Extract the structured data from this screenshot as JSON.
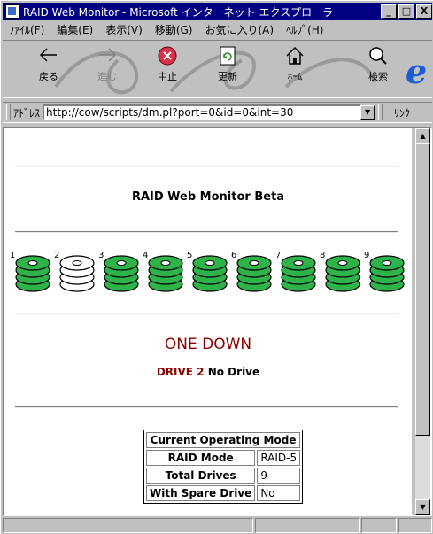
{
  "window": {
    "title": "RAID Web Monitor - Microsoft インターネット エクスプローラ",
    "controls": {
      "minimize": "_",
      "maximize": "□",
      "close": "X"
    }
  },
  "menu": [
    "ﾌｧｲﾙ(F)",
    "編集(E)",
    "表示(V)",
    "移動(G)",
    "お気に入り(A)",
    "ﾍﾙﾌﾟ(H)"
  ],
  "toolbar": {
    "back": "戻る",
    "forward": "進む",
    "stop": "中止",
    "refresh": "更新",
    "home": "ﾎｰﾑ",
    "search": "検索"
  },
  "address": {
    "label": "ｱﾄﾞﾚｽ",
    "url": "http://cow/scripts/dm.pl?port=0&id=0&int=30",
    "links": "ﾘﾝｸ"
  },
  "page": {
    "title": "RAID Web Monitor Beta",
    "status": "ONE DOWN",
    "detail_drive": "DRIVE 2",
    "detail_state": "No Drive"
  },
  "drives": [
    {
      "label": "1",
      "state": "ok"
    },
    {
      "label": "2",
      "state": "missing"
    },
    {
      "label": "3",
      "state": "ok"
    },
    {
      "label": "4",
      "state": "ok"
    },
    {
      "label": "5",
      "state": "ok"
    },
    {
      "label": "6",
      "state": "ok"
    },
    {
      "label": "7",
      "state": "ok"
    },
    {
      "label": "8",
      "state": "ok"
    },
    {
      "label": "9",
      "state": "ok"
    }
  ],
  "mode_table": {
    "header": "Current Operating Mode",
    "rows": [
      {
        "key": "RAID Mode",
        "value": "RAID-5"
      },
      {
        "key": "Total Drives",
        "value": "9"
      },
      {
        "key": "With Spare Drive",
        "value": "No"
      }
    ]
  },
  "colors": {
    "ok_disk": "#2db34a",
    "missing_disk": "#ffffff",
    "alert": "#8b0000",
    "titlebar": "#000080"
  }
}
